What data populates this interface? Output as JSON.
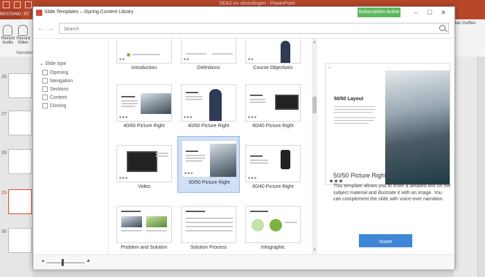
{
  "ppt": {
    "title": "SEAS en uitvindingen - PowerPoint",
    "file_tab": "BESTAND",
    "second_tab": "ST",
    "ribbon_buttons": [
      {
        "label": "Record Audio"
      },
      {
        "label": "Record Video"
      }
    ],
    "name_group": "Narration",
    "user": "Jan Geffen",
    "slide_numbers": [
      "26",
      "27",
      "28",
      "29",
      "30"
    ],
    "selected_slide": "29"
  },
  "dialog": {
    "title": "Slide Templates – iSpring Content Library",
    "subscription_status": "Subscription Active",
    "search_placeholder": "Search",
    "filter": {
      "heading": "Slide type",
      "items": [
        "Opening",
        "Navigation",
        "Sections",
        "Content",
        "Closing"
      ]
    },
    "templates": [
      {
        "label": "Introduction"
      },
      {
        "label": "Definitions"
      },
      {
        "label": "Course Objectives"
      },
      {
        "label": "40/60 Picture Right"
      },
      {
        "label": "40/60 Picture Right"
      },
      {
        "label": "60/40 Picture Right"
      },
      {
        "label": "Video"
      },
      {
        "label": "50/50 Picture Right",
        "selected": true
      },
      {
        "label": "60/40 Picture Right"
      },
      {
        "label": "Problem and Solution"
      },
      {
        "label": "Solution Process"
      },
      {
        "label": "Infographic"
      }
    ],
    "preview": {
      "slide_title": "50/50 Layout",
      "name": "50/50 Picture Right",
      "description": "This template allows you to enter a detailed text on the subject material and illustrate it with an image. You can complement the slide with voice-over narration.",
      "insert_label": "Insert"
    },
    "colors": {
      "accent": "#3f86d6",
      "subscription": "#5cb85c",
      "selection": "#cfe0f7",
      "ppt_brand": "#b7472a"
    }
  }
}
